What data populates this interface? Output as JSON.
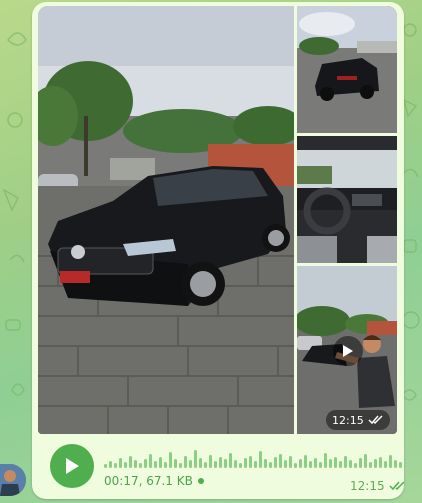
{
  "media": {
    "main_photo": "black SUV parked on cobblestone lot",
    "thumb_1": "SUV rear view",
    "thumb_2": "car interior dashboard",
    "thumb_3": "video of man near car",
    "video_time": "12:15"
  },
  "voice": {
    "duration_size": "00:17, 67.1 KB",
    "time": "12:15"
  },
  "colors": {
    "bubble": "#effdde",
    "accent": "#4fae4e"
  }
}
